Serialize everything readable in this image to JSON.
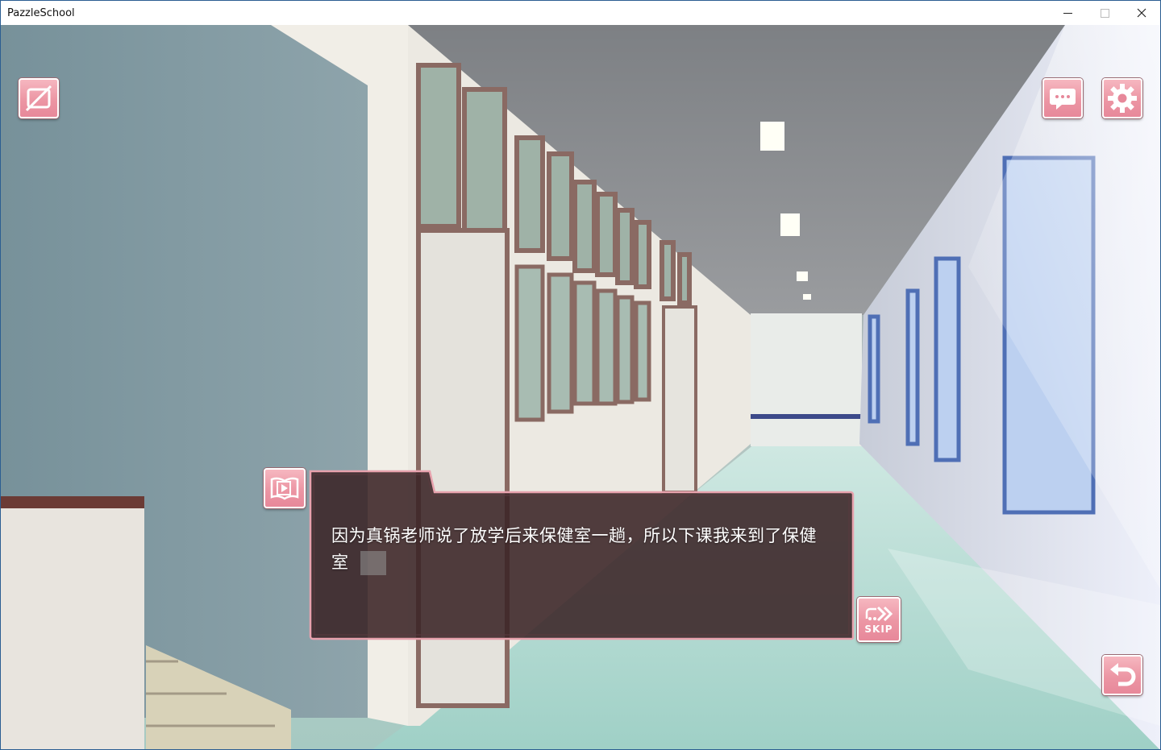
{
  "window": {
    "title": "PazzleSchool",
    "controls": {
      "minimize": "minimize-icon",
      "maximize": "maximize-icon",
      "close": "close-icon"
    }
  },
  "hud": {
    "top_left": [
      {
        "name": "hide-ui-button",
        "icon": "hide-icon"
      }
    ],
    "top_right": [
      {
        "name": "backlog-button",
        "icon": "speech-bubble-icon"
      },
      {
        "name": "settings-button",
        "icon": "gear-icon"
      }
    ],
    "bottom_right": [
      {
        "name": "back-button",
        "icon": "undo-arrow-icon"
      }
    ]
  },
  "dialog": {
    "text": "因为真锅老师说了放学后来保健室一趟，所以下课我来到了保健室",
    "auto_button": {
      "icon": "book-play-icon"
    },
    "skip_button": {
      "label": "SKIP",
      "icon": "fast-forward-icon"
    }
  },
  "colors": {
    "button_pink": "#ec96a4",
    "dialog_fill": "#3a2326",
    "dialog_border": "#e7a2ad"
  }
}
